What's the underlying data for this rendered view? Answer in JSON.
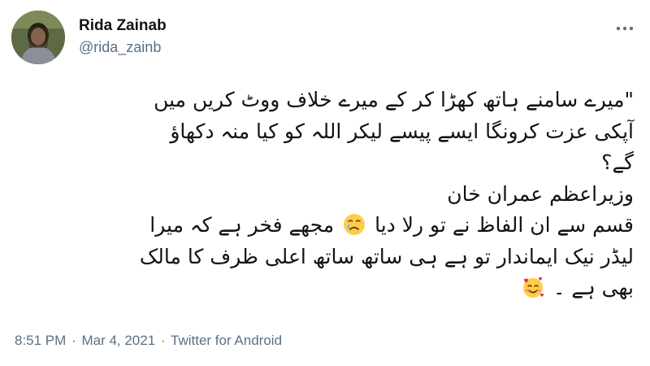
{
  "author": {
    "name": "Rida Zainab",
    "handle": "@rida_zainb"
  },
  "icons": {
    "more": "more-options-icon",
    "crying_face": "crying-face-emoji",
    "smiling_hearts": "smiling-face-with-hearts-emoji"
  },
  "tweet": {
    "lines": [
      "\"میرے سامنے ہاتھ کھڑا کر کے میرے خلاف ووٹ کریں میں",
      "آپکی عزت کرونگا ایسے پیسے لیکر اللہ کو کیا منہ دکھاؤ",
      "گے؟",
      "وزیراعظم عمران خان",
      "قسم سے ان الفاظ نے تو رلا دیا",
      "مجھے فخر ہے کہ میرا",
      "لیڈر نیک ایماندار تو ہے ہی ساتھ ساتھ اعلی ظرف کا مالک",
      "بھی ہے ۔"
    ]
  },
  "meta": {
    "time": "8:51 PM",
    "separator": "·",
    "date": "Mar 4, 2021",
    "source": "Twitter for Android"
  },
  "colors": {
    "text": "#0f1419",
    "secondary": "#5b7083",
    "emoji_yellow": "#ffcc4d",
    "heart_red": "#dd2e44"
  }
}
